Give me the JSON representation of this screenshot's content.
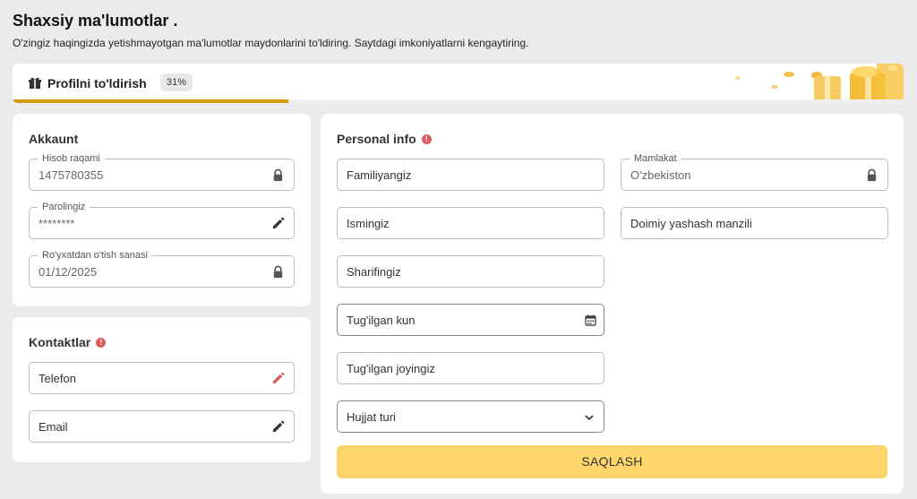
{
  "header": {
    "title": "Shaxsiy ma'lumotlar .",
    "subtitle": "O'zingiz haqingizda yetishmayotgan ma'lumotlar maydonlarini to'ldiring. Saytdagi imkoniyatlarni kengaytiring."
  },
  "progress": {
    "label": "Profilni to'ldirish",
    "percent_text": "31%",
    "fraction": 0.31,
    "bar_color": "#d69a11"
  },
  "account": {
    "title": "Akkaunt",
    "fields": [
      {
        "label": "Hisob raqami",
        "value": "1475780355",
        "icon": "lock-icon"
      },
      {
        "label": "Parolingiz",
        "value": "********",
        "icon": "pencil-icon"
      },
      {
        "label": "Ro'yxatdan o'tish sanasi",
        "value": "01/12/2025",
        "icon": "lock-icon"
      }
    ]
  },
  "contacts": {
    "title": "Kontaktlar",
    "fields": [
      {
        "placeholder": "Telefon",
        "icon": "pencil-icon",
        "icon_color": "#e05a5a"
      },
      {
        "placeholder": "Email",
        "icon": "pencil-icon"
      }
    ]
  },
  "personal": {
    "title": "Personal info",
    "left_fields": [
      "Familiyangiz",
      "Ismingiz",
      "Sharifingiz",
      "Tug'ilgan kun",
      "Tug'ilgan joyingiz",
      "Hujjat turi"
    ],
    "country_label": "Mamlakat",
    "country_value": "O'zbekiston",
    "address_placeholder": "Doimiy yashash manzili",
    "save_label": "SAQLASH"
  },
  "colors": {
    "accent": "#fdd56b",
    "warning": "#e05a5a"
  }
}
